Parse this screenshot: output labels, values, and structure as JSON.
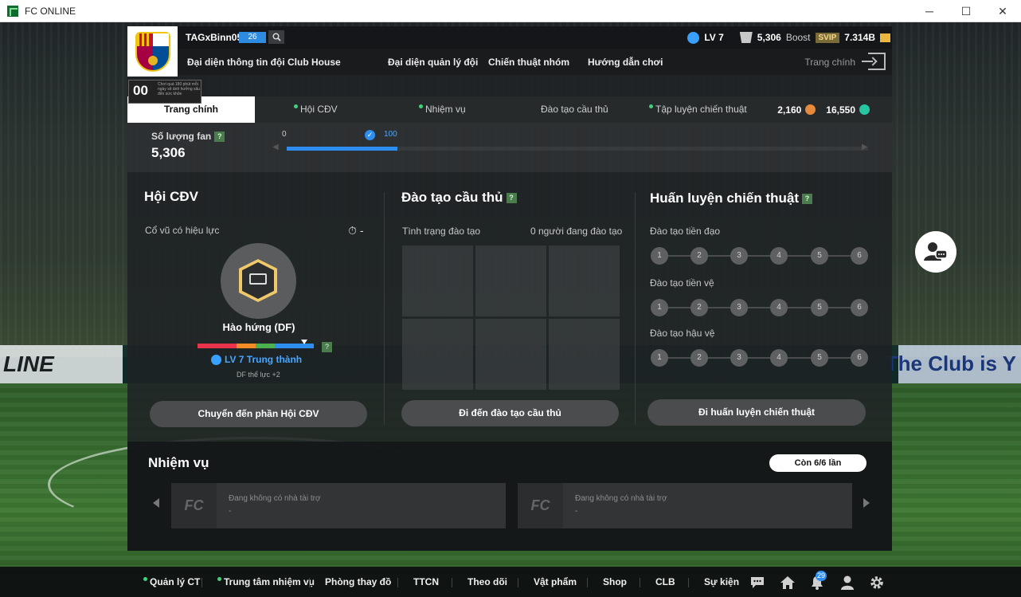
{
  "window": {
    "title": "FC ONLINE",
    "minimize": "─",
    "maximize": "☐",
    "close": "✕"
  },
  "profile": {
    "username": "TAGxBinn05",
    "team_ovr": "26",
    "level": "LV 7",
    "fans": "5,306",
    "boost_label": "Boost",
    "vip": "SVIP",
    "coins": "7.314B"
  },
  "nav": {
    "items": [
      "Đại diện thông tin đội",
      "Club House",
      "Đại diện quản lý đội",
      "Chiến thuật nhóm",
      "Hướng dẫn chơi"
    ],
    "home_label": "Trang chính"
  },
  "promo": {
    "big": "00",
    "small": "Chơi quá 180 phút mỗi ngày sẽ ảnh hưởng xấu đến sức khỏe"
  },
  "tabs": {
    "items": [
      {
        "label": "Trang chính",
        "dot": false
      },
      {
        "label": "Hội CĐV",
        "dot": true
      },
      {
        "label": "Nhiệm vụ",
        "dot": true
      },
      {
        "label": "Đào tạo cầu thủ",
        "dot": false
      },
      {
        "label": "Tập luyện chiến thuật",
        "dot": true
      }
    ],
    "currency_orange": "2,160",
    "currency_teal": "16,550"
  },
  "fans": {
    "label": "Số lượng fan",
    "value": "5,306",
    "help": "?",
    "progress_start": "0",
    "progress_target": "100",
    "progress_fraction": 0.19
  },
  "club": {
    "title": "Hội CĐV",
    "cheer_label": "Cổ vũ có hiệu lực",
    "timer_value": "-",
    "mood": "Hào hứng (DF)",
    "loyalty": "LV 7 Trung thành",
    "bonus": "DF thể lực +2",
    "mood_fraction": 0.92,
    "mood_colors": [
      "#e8334b",
      "#e8334b",
      "#f28c28",
      "#4caf50",
      "#2e8ef0",
      "#2e8ef0"
    ],
    "cta": "Chuyển đến phần Hội CĐV"
  },
  "training": {
    "title": "Đào tạo cầu thủ",
    "status_label": "Tình trạng đào tạo",
    "status_value": "0 người đang đào tạo",
    "cta": "Đi đến đào tạo cầu thủ"
  },
  "tactics": {
    "title": "Huấn luyện chiến thuật",
    "rows": [
      {
        "label": "Đào tạo tiền đạo",
        "nodes": [
          "1",
          "2",
          "3",
          "4",
          "5",
          "6"
        ]
      },
      {
        "label": "Đào tạo tiền vệ",
        "nodes": [
          "1",
          "2",
          "3",
          "4",
          "5",
          "6"
        ]
      },
      {
        "label": "Đào tạo hậu vệ",
        "nodes": [
          "1",
          "2",
          "3",
          "4",
          "5",
          "6"
        ]
      }
    ],
    "cta": "Đi huấn luyện chiến thuật"
  },
  "missions": {
    "title": "Nhiệm vụ",
    "remaining": "Còn 6/6 lần",
    "cards": [
      {
        "text": "Đang không có nhà tài trợ",
        "sub": "-",
        "logo": "FC"
      },
      {
        "text": "Đang không có nhà tài trợ",
        "sub": "-",
        "logo": "FC"
      }
    ]
  },
  "background": {
    "adboard_left": "LINE",
    "adboard_right": "The Club is Y"
  },
  "bottom_nav": {
    "items": [
      {
        "label": "Quản lý CT",
        "dot": true
      },
      {
        "label": "Trung tâm nhiệm vụ",
        "dot": true
      },
      {
        "label": "Phòng thay đồ",
        "dot": false
      },
      {
        "label": "TTCN",
        "dot": false
      },
      {
        "label": "Theo dõi",
        "dot": false
      },
      {
        "label": "Vật phẩm",
        "dot": false
      },
      {
        "label": "Shop",
        "dot": false
      },
      {
        "label": "CLB",
        "dot": false
      },
      {
        "label": "Sự kiện",
        "dot": false
      }
    ],
    "notification_count": "29",
    "icons": [
      "chat-icon",
      "home-icon",
      "bell-icon",
      "profile-icon",
      "settings-icon"
    ]
  }
}
